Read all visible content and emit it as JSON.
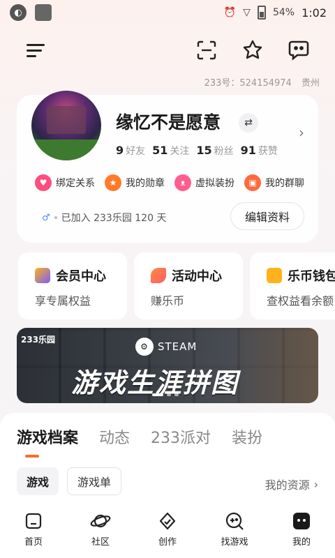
{
  "status_bar": {
    "battery": "54%",
    "time": "1:02"
  },
  "header": {
    "uid_label": "233号：",
    "uid": "524154974",
    "location": "贵州"
  },
  "profile": {
    "name": "缘忆不是愿意",
    "switch_icon": "⇄",
    "stats": [
      {
        "num": "9",
        "label": "好友"
      },
      {
        "num": "51",
        "label": "关注"
      },
      {
        "num": "15",
        "label": "粉丝"
      },
      {
        "num": "91",
        "label": "获赞"
      }
    ],
    "features": [
      {
        "label": "绑定关系",
        "icon": "heart-icon",
        "color": "#ff4d7d"
      },
      {
        "label": "我的勋章",
        "icon": "medal-icon",
        "color": "#ff7a2b"
      },
      {
        "label": "虚拟装扮",
        "icon": "cat-icon",
        "color": "#ff5d8f"
      },
      {
        "label": "我的群聊",
        "icon": "chat-group-icon",
        "color": "#ff6a3d"
      }
    ],
    "joined_text": "已加入 233乐园 120 天",
    "edit_label": "编辑资料"
  },
  "quick_cards": [
    {
      "title": "会员中心",
      "subtitle": "享专属权益",
      "icon": "crown-icon",
      "color": "#7b5cff"
    },
    {
      "title": "活动中心",
      "subtitle": "赚乐币",
      "icon": "party-icon",
      "color": "#ff5a6e"
    },
    {
      "title": "乐币钱包",
      "subtitle": "查权益看余额",
      "icon": "wallet-icon",
      "color": "#ffb21a"
    }
  ],
  "banner": {
    "brand": "233乐园",
    "steam": "STEAM",
    "title": "游戏生涯拼图"
  },
  "tabs": [
    "游戏档案",
    "动态",
    "233派对",
    "装扮"
  ],
  "subtabs": [
    "游戏",
    "游戏单"
  ],
  "resource_link": "我的资源",
  "bottom_nav": [
    {
      "label": "首页",
      "icon": "home-icon"
    },
    {
      "label": "社区",
      "icon": "planet-icon"
    },
    {
      "label": "创作",
      "icon": "create-icon"
    },
    {
      "label": "找游戏",
      "icon": "gamepad-search-icon"
    },
    {
      "label": "我的",
      "icon": "profile-icon"
    }
  ],
  "colors": {
    "accent": "#ff6a2b",
    "background": "#f8f4f6"
  }
}
